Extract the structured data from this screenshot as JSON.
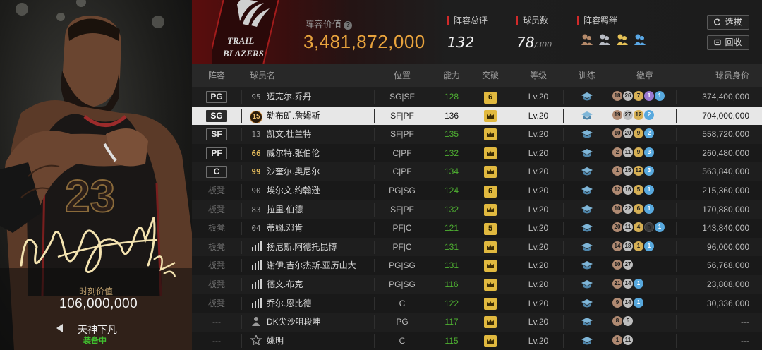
{
  "card": {
    "jersey_number": "23",
    "value_label": "时刻价值",
    "value": "106,000,000",
    "name": "天神下凡",
    "status": "装备中"
  },
  "header": {
    "team_logo_text": [
      "TRAIL",
      "BLAZERS"
    ],
    "lineup_value_label": "阵容价值",
    "lineup_value": "3,481,872,000",
    "rating_label": "阵容总评",
    "rating": "132",
    "players_label": "球员数",
    "players": "78",
    "players_max": "/300",
    "bond_label": "阵容羁绊",
    "bond_icons": [
      "bond-bronze-icon",
      "bond-silver-icon",
      "bond-gold-icon",
      "bond-blue-icon"
    ],
    "select_label": "选拔",
    "recycle_label": "回收"
  },
  "columns": [
    "阵容",
    "球员名",
    "位置",
    "能力",
    "突破",
    "等级",
    "训练",
    "徽章",
    "球员身价"
  ],
  "rows": [
    {
      "slot": "PG",
      "num": "95",
      "name": "迈克尔.乔丹",
      "role": "SG|SF",
      "ability": "128",
      "break": "6",
      "level": "Lv.20",
      "train": true,
      "badges": [
        {
          "t": "b",
          "v": "18"
        },
        {
          "t": "s",
          "v": "26"
        },
        {
          "t": "g",
          "v": "7"
        },
        {
          "t": "p",
          "v": "1"
        },
        {
          "t": "u",
          "v": "1"
        }
      ],
      "worth": "374,400,000"
    },
    {
      "slot": "SG",
      "num": "15",
      "name": "勒布朗.詹姆斯",
      "role": "SF|PF",
      "ability": "136",
      "break": "crown",
      "level": "Lv.20",
      "train": true,
      "badges": [
        {
          "t": "b",
          "v": "19"
        },
        {
          "t": "s",
          "v": "27"
        },
        {
          "t": "g",
          "v": "12"
        },
        {
          "t": "u",
          "v": "2"
        }
      ],
      "worth": "704,000,000"
    },
    {
      "slot": "SF",
      "num": "13",
      "name": "凯文.杜兰特",
      "role": "SF|PF",
      "ability": "135",
      "break": "crown",
      "level": "Lv.20",
      "train": true,
      "badges": [
        {
          "t": "b",
          "v": "10"
        },
        {
          "t": "s",
          "v": "20"
        },
        {
          "t": "g",
          "v": "9"
        },
        {
          "t": "u",
          "v": "2"
        }
      ],
      "worth": "558,720,000"
    },
    {
      "slot": "PF",
      "num": "66",
      "name": "威尔特.张伯伦",
      "role": "C|PF",
      "ability": "132",
      "break": "crown",
      "level": "Lv.20",
      "train": true,
      "badges": [
        {
          "t": "b",
          "v": "2"
        },
        {
          "t": "s",
          "v": "11"
        },
        {
          "t": "g",
          "v": "9"
        },
        {
          "t": "u",
          "v": "3"
        }
      ],
      "worth": "260,480,000"
    },
    {
      "slot": "C",
      "num": "99",
      "name": "沙奎尔.奥尼尔",
      "role": "C|PF",
      "ability": "134",
      "break": "crown",
      "level": "Lv.20",
      "train": true,
      "badges": [
        {
          "t": "b",
          "v": "1"
        },
        {
          "t": "s",
          "v": "15"
        },
        {
          "t": "g",
          "v": "12"
        },
        {
          "t": "u",
          "v": "3"
        }
      ],
      "worth": "563,840,000"
    },
    {
      "slot": "板凳",
      "num": "90",
      "name": "埃尔文.约翰逊",
      "role": "PG|SG",
      "ability": "124",
      "break": "6",
      "level": "Lv.20",
      "train": true,
      "badges": [
        {
          "t": "b",
          "v": "12"
        },
        {
          "t": "s",
          "v": "16"
        },
        {
          "t": "g",
          "v": "5"
        },
        {
          "t": "u",
          "v": "1"
        }
      ],
      "worth": "215,360,000"
    },
    {
      "slot": "板凳",
      "num": "83",
      "name": "拉里.伯德",
      "role": "SF|PF",
      "ability": "132",
      "break": "crown",
      "level": "Lv.20",
      "train": true,
      "badges": [
        {
          "t": "b",
          "v": "10"
        },
        {
          "t": "s",
          "v": "22"
        },
        {
          "t": "g",
          "v": "6"
        },
        {
          "t": "u",
          "v": "1"
        }
      ],
      "worth": "170,880,000"
    },
    {
      "slot": "板凳",
      "num": "04",
      "name": "蒂姆.邓肯",
      "role": "PF|C",
      "ability": "121",
      "break": "5",
      "level": "Lv.20",
      "train": true,
      "badges": [
        {
          "t": "b",
          "v": "20"
        },
        {
          "t": "s",
          "v": "11"
        },
        {
          "t": "g",
          "v": "4"
        },
        {
          "t": "n",
          "v": "0"
        },
        {
          "t": "u",
          "v": "1"
        }
      ],
      "worth": "143,840,000"
    },
    {
      "slot": "板凳",
      "num": "",
      "name": "扬尼斯.阿德托昆博",
      "role": "PF|C",
      "ability": "131",
      "break": "crown",
      "level": "Lv.20",
      "train": true,
      "badges": [
        {
          "t": "b",
          "v": "14"
        },
        {
          "t": "s",
          "v": "18"
        },
        {
          "t": "g",
          "v": "1"
        },
        {
          "t": "u",
          "v": "1"
        }
      ],
      "worth": "96,000,000"
    },
    {
      "slot": "板凳",
      "num": "",
      "name": "谢伊.吉尔杰斯.亚历山大",
      "role": "PG|SG",
      "ability": "131",
      "break": "crown",
      "level": "Lv.20",
      "train": true,
      "badges": [
        {
          "t": "b",
          "v": "10"
        },
        {
          "t": "s",
          "v": "27"
        }
      ],
      "worth": "56,768,000"
    },
    {
      "slot": "板凳",
      "num": "",
      "name": "德文.布克",
      "role": "PG|SG",
      "ability": "116",
      "break": "crown",
      "level": "Lv.20",
      "train": true,
      "badges": [
        {
          "t": "b",
          "v": "21"
        },
        {
          "t": "s",
          "v": "14"
        },
        {
          "t": "u",
          "v": "1"
        }
      ],
      "worth": "23,808,000"
    },
    {
      "slot": "板凳",
      "num": "",
      "name": "乔尔.恩比德",
      "role": "C",
      "ability": "122",
      "break": "crown",
      "level": "Lv.20",
      "train": true,
      "badges": [
        {
          "t": "b",
          "v": "9"
        },
        {
          "t": "s",
          "v": "14"
        },
        {
          "t": "u",
          "v": "1"
        }
      ],
      "worth": "30,336,000"
    },
    {
      "slot": "---",
      "num": "",
      "name": "DK尖沙咀段坤",
      "role": "PG",
      "ability": "117",
      "break": "crown",
      "level": "Lv.20",
      "train": true,
      "badges": [
        {
          "t": "b",
          "v": "8"
        },
        {
          "t": "s",
          "v": "5"
        }
      ],
      "worth": "---"
    },
    {
      "slot": "---",
      "num": "",
      "name": "姚明",
      "role": "C",
      "ability": "115",
      "break": "crown",
      "level": "Lv.20",
      "train": true,
      "badges": [
        {
          "t": "b",
          "v": "1"
        },
        {
          "t": "s",
          "v": "11"
        }
      ],
      "worth": "---"
    }
  ],
  "colors": {
    "accent": "#e8a33d",
    "ability_green": "#4fb232",
    "status_green": "#3fbf2e",
    "brand_red": "#d12a2a"
  }
}
